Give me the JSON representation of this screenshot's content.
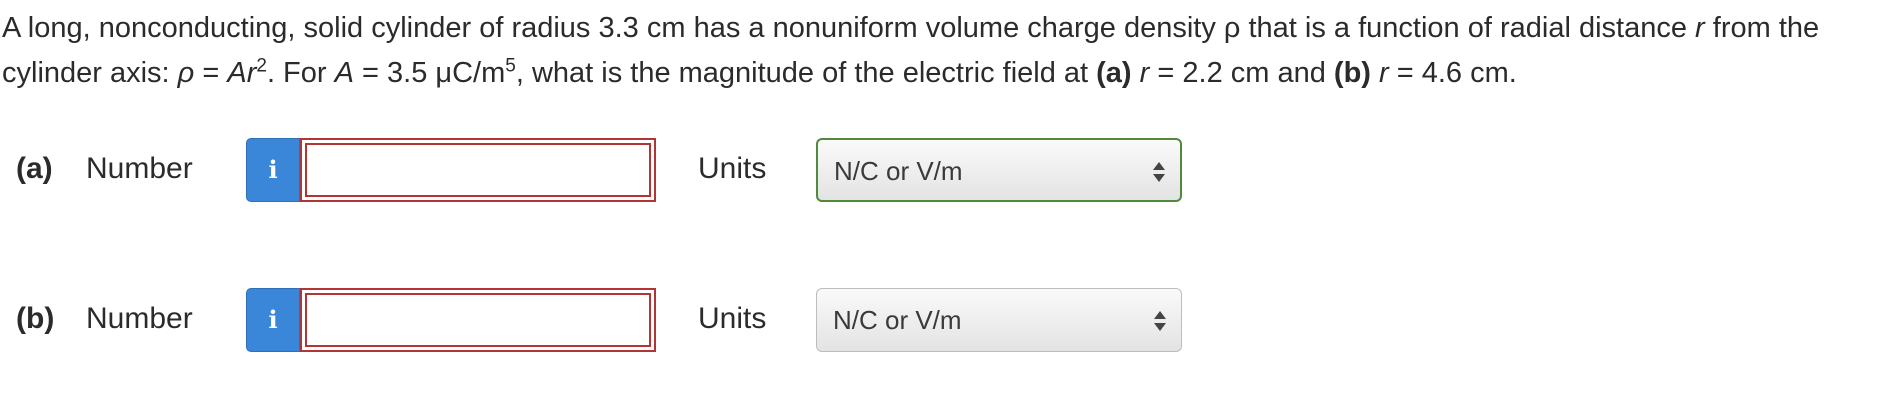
{
  "question": {
    "seg1": "A long, nonconducting, solid cylinder of radius 3.3 cm has a nonuniform volume charge density ρ that is a function of radial distance ",
    "var_r1": "r",
    "seg2": " from the cylinder axis: ",
    "var_rho": "ρ",
    "seg3": " = ",
    "var_Ar": "Ar",
    "exp2": "2",
    "seg4": ". For ",
    "var_A": "A",
    "seg5": " = 3.5 μC/m",
    "exp5": "5",
    "seg6": ", what is the magnitude of the electric field at ",
    "part_a": "(a)",
    "seg7": " ",
    "var_r2": "r",
    "seg8": " = 2.2 cm and ",
    "part_b": "(b)",
    "seg9": " ",
    "var_r3": "r",
    "seg10": " = 4.6 cm."
  },
  "parts": [
    {
      "label": "(a)",
      "number_label": "Number",
      "info_icon": "i",
      "number_value": "",
      "units_label": "Units",
      "units_selected": "N/C or V/m"
    },
    {
      "label": "(b)",
      "number_label": "Number",
      "info_icon": "i",
      "number_value": "",
      "units_label": "Units",
      "units_selected": "N/C or V/m"
    }
  ],
  "colors": {
    "info_button": "#3a87d9",
    "input_error_border": "#b23434",
    "select_focus_border": "#4f8a3d",
    "text": "#2b2b2b"
  }
}
